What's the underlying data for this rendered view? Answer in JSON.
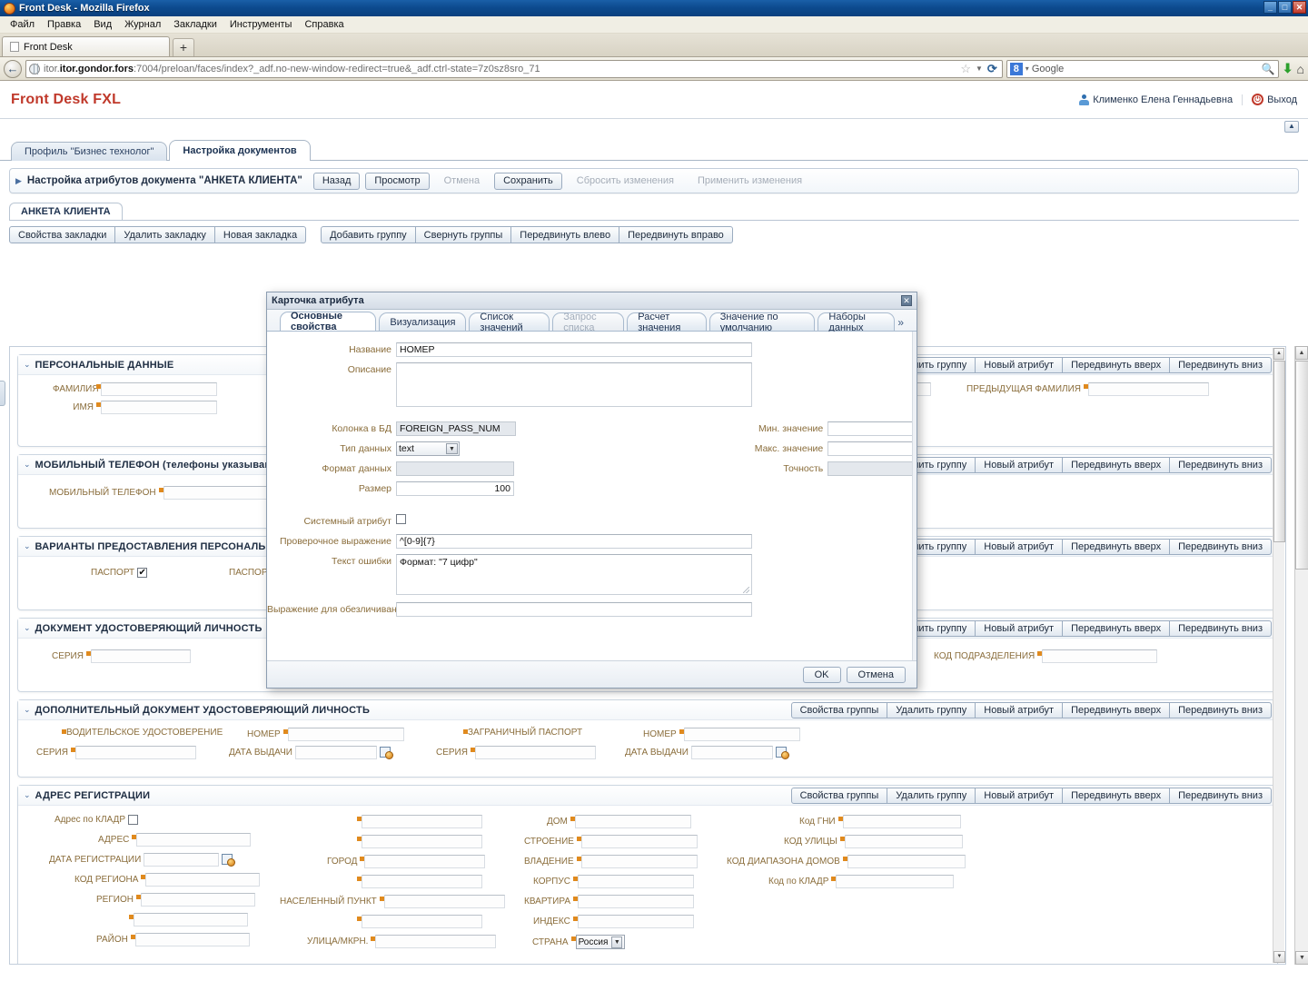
{
  "browser": {
    "window_title": "Front Desk - Mozilla Firefox",
    "menus": [
      "Файл",
      "Правка",
      "Вид",
      "Журнал",
      "Закладки",
      "Инструменты",
      "Справка"
    ],
    "tab_title": "Front Desk",
    "new_tab_label": "+",
    "url_host": "itor.gondor.fors",
    "url_rest": ":7004/preloan/faces/index?_adf.no-new-window-redirect=true&_adf.ctrl-state=7z0sz8sro_71",
    "search_engine": "Google",
    "search_engine_badge": "8",
    "win_min": "_",
    "win_max": "□",
    "win_close": "✕"
  },
  "app": {
    "brand_primary": "Front Desk",
    "brand_accent": "FXL",
    "user_name": "Клименко Елена Геннадьевна",
    "logout_label": "Выход",
    "main_tabs": [
      {
        "label": "Профиль \"Бизнес технолог\"",
        "active": false
      },
      {
        "label": "Настройка документов",
        "active": true
      }
    ],
    "panel": {
      "title": "Настройка атрибутов документа \"АНКЕТА КЛИЕНТА\"",
      "buttons": [
        {
          "label": "Назад",
          "disabled": false
        },
        {
          "label": "Просмотр",
          "disabled": false
        },
        {
          "label": "Отмена",
          "disabled": true
        },
        {
          "label": "Сохранить",
          "disabled": false
        },
        {
          "label": "Сбросить изменения",
          "disabled": true
        },
        {
          "label": "Применить изменения",
          "disabled": true
        }
      ]
    },
    "doc_tab": "АНКЕТА КЛИЕНТА",
    "bookmark_toolbar_left": [
      "Свойства закладки",
      "Удалить закладку",
      "Новая закладка"
    ],
    "bookmark_toolbar_right": [
      "Добавить группу",
      "Свернуть группы",
      "Передвинуть влево",
      "Передвинуть вправо"
    ],
    "group_buttons": [
      "Свойства группы",
      "Удалить группу",
      "Новый атрибут",
      "Передвинуть вверх",
      "Передвинуть вниз"
    ],
    "country_value": "Россия"
  },
  "groups": [
    {
      "title": "ПЕРСОНАЛЬНЫЕ ДАННЫЕ",
      "fields_left": [
        "ФАМИЛИЯ",
        "ИМЯ"
      ],
      "fields_right": [
        "ПРЕДЫДУЩАЯ ФАМИЛИЯ"
      ]
    },
    {
      "title": "МОБИЛЬНЫЙ ТЕЛЕФОН (телефоны указываются в формате",
      "fields_left": [
        "МОБИЛЬНЫЙ ТЕЛЕФОН"
      ],
      "fields_right": []
    },
    {
      "title": "ВАРИАНТЫ ПРЕДОСТАВЛЕНИЯ ПЕРСОНАЛЬНЫХ ДАННЫХ",
      "checkbox_1": "ПАСПОРТ",
      "checkbox_1_checked": true,
      "checkbox_2": "ПАСПОРТ И ОТ",
      "fields_right": []
    },
    {
      "title": "ДОКУМЕНТ УДОСТОВЕРЯЮЩИЙ ЛИЧНОСТЬ",
      "fields_left": [
        "СЕРИЯ"
      ],
      "fields_right": [
        "КОД ПОДРАЗДЕЛЕНИЯ"
      ]
    },
    {
      "title": "ДОПОЛНИТЕЛЬНЫЙ ДОКУМЕНТ УДОСТОВЕРЯЮЩИЙ ЛИЧНОСТЬ",
      "doc_columns": [
        {
          "header": "ВОДИТЕЛЬСКОЕ УДОСТОВЕРЕНИЕ",
          "row_label": "СЕРИЯ"
        },
        {
          "header": "НОМЕР",
          "row_label": "ДАТА ВЫДАЧИ"
        },
        {
          "header": "ЗАГРАНИЧНЫЙ ПАСПОРТ",
          "row_label": "СЕРИЯ"
        },
        {
          "header": "НОМЕР",
          "row_label": "ДАТА ВЫДАЧИ"
        }
      ]
    },
    {
      "title": "АДРЕС РЕГИСТРАЦИИ",
      "col1": [
        {
          "label": "Адрес по КЛАДР",
          "type": "checkbox"
        },
        {
          "label": "АДРЕС",
          "type": "text"
        },
        {
          "label": "ДАТА РЕГИСТРАЦИИ",
          "type": "date"
        },
        {
          "label": "КОД РЕГИОНА",
          "type": "text"
        },
        {
          "label": "РЕГИОН",
          "type": "text"
        },
        {
          "label": "",
          "type": "text"
        },
        {
          "label": "РАЙОН",
          "type": "text"
        }
      ],
      "col2": [
        {
          "label": "",
          "type": "text"
        },
        {
          "label": "",
          "type": "text"
        },
        {
          "label": "ГОРОД",
          "type": "text"
        },
        {
          "label": "",
          "type": "text"
        },
        {
          "label": "НАСЕЛЕННЫЙ ПУНКТ",
          "type": "text"
        },
        {
          "label": "",
          "type": "text"
        },
        {
          "label": "УЛИЦА/МКРН.",
          "type": "text"
        }
      ],
      "col3": [
        {
          "label": "ДОМ",
          "type": "text"
        },
        {
          "label": "СТРОЕНИЕ",
          "type": "text"
        },
        {
          "label": "ВЛАДЕНИЕ",
          "type": "text"
        },
        {
          "label": "КОРПУС",
          "type": "text"
        },
        {
          "label": "КВАРТИРА",
          "type": "text"
        },
        {
          "label": "ИНДЕКС",
          "type": "text"
        },
        {
          "label": "СТРАНА",
          "type": "select"
        }
      ],
      "col4": [
        {
          "label": "Код ГНИ",
          "type": "text"
        },
        {
          "label": "КОД УЛИЦЫ",
          "type": "text"
        },
        {
          "label": "КОД ДИАПАЗОНА ДОМОВ",
          "type": "text"
        },
        {
          "label": "Код по КЛАДР",
          "type": "text"
        }
      ]
    }
  ],
  "dialog": {
    "title": "Карточка атрибута",
    "close_label": "✕",
    "tabs": [
      {
        "label": "Основные свойства",
        "state": "active"
      },
      {
        "label": "Визуализация",
        "state": "normal"
      },
      {
        "label": "Список значений",
        "state": "normal"
      },
      {
        "label": "Запрос списка",
        "state": "disabled"
      },
      {
        "label": "Расчет значения",
        "state": "normal"
      },
      {
        "label": "Значение по умолчанию",
        "state": "normal"
      },
      {
        "label": "Наборы данных",
        "state": "normal"
      }
    ],
    "tabs_more": "»",
    "fields": {
      "name_label": "Название",
      "name_value": "НОМЕР",
      "description_label": "Описание",
      "description_value": "",
      "db_column_label": "Колонка в БД",
      "db_column_value": "FOREIGN_PASS_NUM",
      "data_type_label": "Тип данных",
      "data_type_value": "text",
      "data_format_label": "Формат данных",
      "data_format_value": "",
      "size_label": "Размер",
      "size_value": "100",
      "min_value_label": "Мин. значение",
      "min_value": "",
      "max_value_label": "Макс. значение",
      "max_value": "",
      "precision_label": "Точность",
      "precision_value": "",
      "system_attr_label": "Системный атрибут",
      "system_attr_checked": false,
      "validation_label": "Проверочное выражение",
      "validation_value": "^[0-9]{7}",
      "error_text_label": "Текст ошибки",
      "error_text_value": "Формат: \"7 цифр\"",
      "anonymize_label": "Выражение для обезличивания",
      "anonymize_value": ""
    },
    "ok_label": "OK",
    "cancel_label": "Отмена"
  }
}
